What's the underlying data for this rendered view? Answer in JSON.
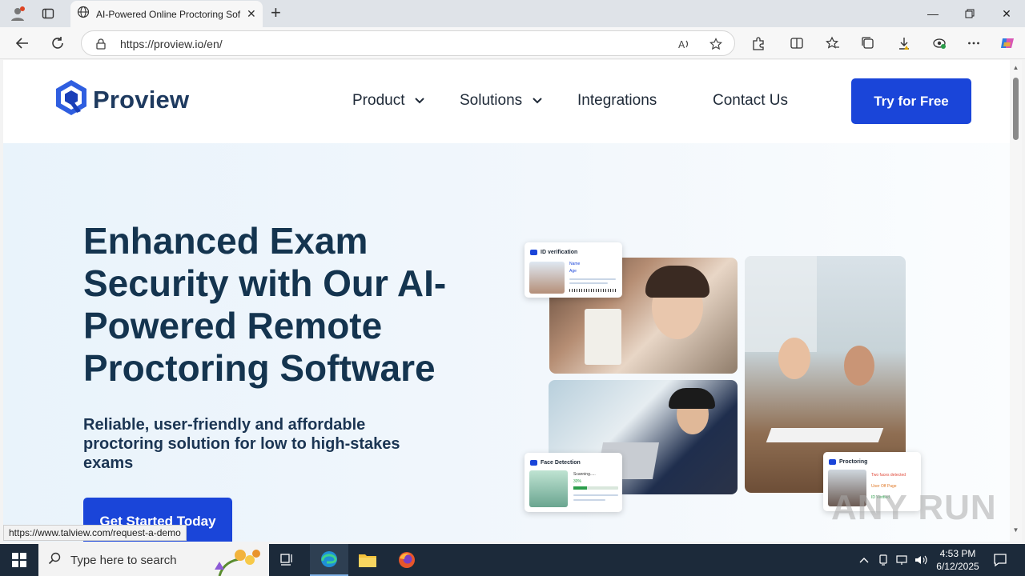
{
  "browser": {
    "tab_title": "AI-Powered Online Proctoring Sof",
    "url": "https://proview.io/en/"
  },
  "site": {
    "logo": "Proview",
    "nav": {
      "product": "Product",
      "solutions": "Solutions",
      "integrations": "Integrations",
      "contact": "Contact Us"
    },
    "cta_top": "Try for Free",
    "hero": {
      "title": "Enhanced Exam Security with Our AI-Powered Remote Proctoring Software",
      "subtitle": "Reliable, user-friendly and affordable proctoring solution for low to high-stakes exams",
      "cta": "Get Started Today"
    },
    "cards": {
      "id_verification": "ID verification",
      "id_name": "Name",
      "id_age": "Age",
      "face_detection": "Face Detection",
      "face_scanning": "Scanning.....",
      "face_percent": "30%",
      "proctoring": "Proctoring",
      "proctoring_1": "Two faces detected",
      "proctoring_2": "User Off Page",
      "proctoring_3": "ID Verified"
    }
  },
  "status_url": "https://www.talview.com/request-a-demo",
  "watermark": "ANY RUN",
  "taskbar": {
    "search_placeholder": "Type here to search",
    "time": "4:53 PM",
    "date": "6/12/2025"
  },
  "colors": {
    "brand_blue": "#1a45d9",
    "heading_navy": "#14344f",
    "hero_bg": "#e9f3fb"
  }
}
